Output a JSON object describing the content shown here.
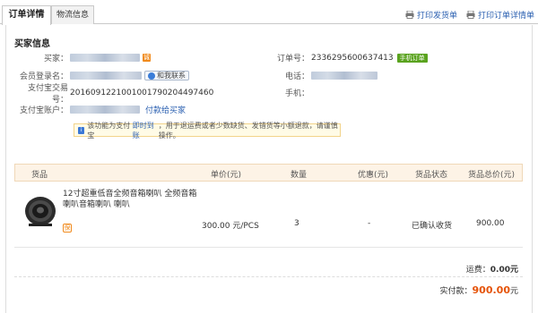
{
  "tabs": [
    {
      "label": "订单详情"
    },
    {
      "label": "物流信息"
    }
  ],
  "print_links": {
    "print_delivery": "打印发货单",
    "print_order": "打印订单详情单"
  },
  "buyer": {
    "section_title": "买家信息",
    "buyer_label": "买家：",
    "member_label": "会员登录名：",
    "contact_label": "和我联系",
    "alipay_trade_label": "支付宝交易号：",
    "alipay_trade_value": "2016091221001001790204497460",
    "alipay_account_label": "支付宝账户：",
    "pay_to_buyer": "付款给买家",
    "badge": "诚"
  },
  "order": {
    "order_no_label": "订单号：",
    "order_no_value": "2336295600637413",
    "mobile_tag": "手机订单",
    "phone_label": "电话：",
    "mobile_label": "手机："
  },
  "notice": {
    "text_before": "该功能为支付宝",
    "highlight": "即时到账",
    "text_after": "，用于退运费或者少数缺货、发错货等小额退款，请谨慎操作。"
  },
  "table": {
    "headers": {
      "goods": "货品",
      "unit_price": "单价(元)",
      "quantity": "数量",
      "discount": "优惠(元)",
      "status": "货品状态",
      "total": "货品总价(元)"
    },
    "rows": [
      {
        "title": "12寸超重低音全频音箱喇叭 全频音箱喇叭音箱喇叭 喇叭",
        "guarantee": "保",
        "unit_price": "300.00 元/PCS",
        "quantity": "3",
        "discount": "-",
        "status": "已确认收货",
        "total": "900.00"
      }
    ]
  },
  "summary": {
    "shipping_label": "运费：",
    "shipping_value": "0.00元",
    "paid_label": "实付款：",
    "paid_value": "900.00",
    "paid_unit": "元"
  },
  "colors": {
    "link": "#2a5fb0",
    "accent_orange": "#e5540a",
    "table_header_bg": "#fdf3e6",
    "mobile_tag_green": "#5aa31f"
  }
}
